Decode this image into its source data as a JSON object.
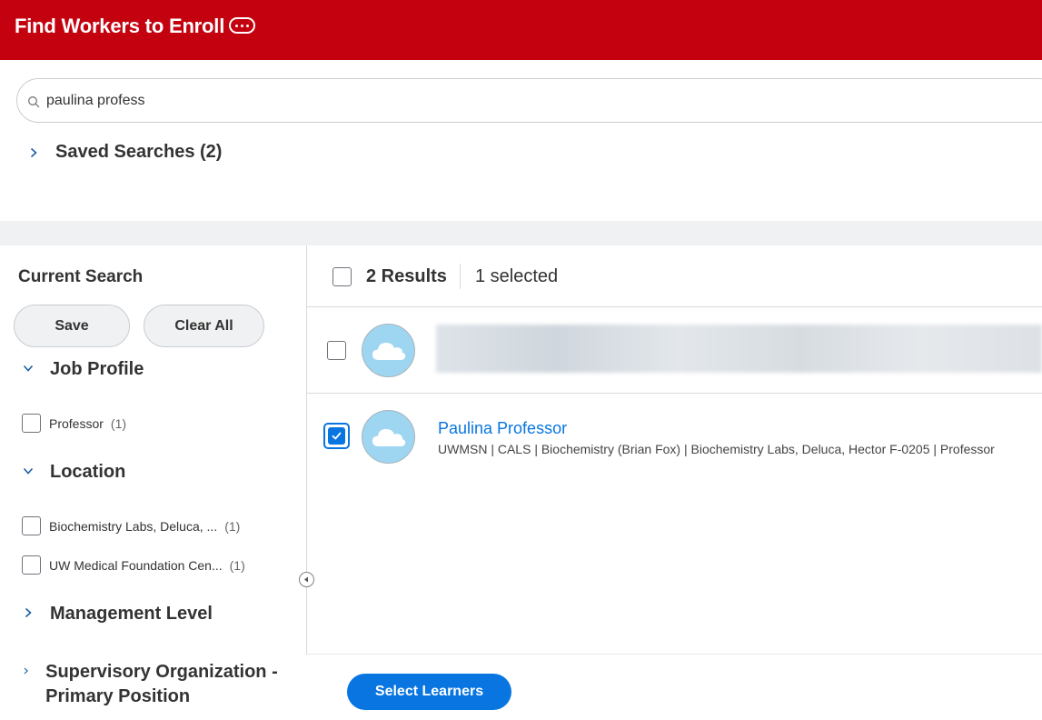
{
  "header": {
    "title": "Find Workers to Enroll",
    "more_icon": "ellipsis-icon"
  },
  "search": {
    "value": "paulina profess",
    "icon": "search-icon"
  },
  "saved_searches": {
    "label": "Saved Searches (2)"
  },
  "filters": {
    "title": "Current Search",
    "save_label": "Save",
    "clear_label": "Clear All",
    "facets": [
      {
        "label": "Job Profile",
        "expanded": true,
        "options": [
          {
            "label": "Professor",
            "count": "(1)"
          }
        ]
      },
      {
        "label": "Location",
        "expanded": true,
        "options": [
          {
            "label": "Biochemistry Labs, Deluca, ...",
            "count": "(1)"
          },
          {
            "label": "UW Medical Foundation Cen...",
            "count": "(1)"
          }
        ]
      },
      {
        "label": "Management Level",
        "expanded": false
      },
      {
        "label": "Supervisory Organization - Primary Position",
        "expanded": false
      }
    ]
  },
  "results": {
    "count_label": "2 Results",
    "selected_label": "1 selected",
    "items": [
      {
        "selected": false,
        "redacted": true
      },
      {
        "selected": true,
        "name": "Paulina Professor",
        "details": "UWMSN | CALS | Biochemistry (Brian Fox) | Biochemistry Labs, Deluca, Hector F-0205 | Professor"
      }
    ]
  },
  "footer": {
    "select_label": "Select Learners"
  },
  "colors": {
    "header_bg": "#c4020f",
    "accent": "#0875e1",
    "avatar_bg": "#9ed6f2"
  }
}
